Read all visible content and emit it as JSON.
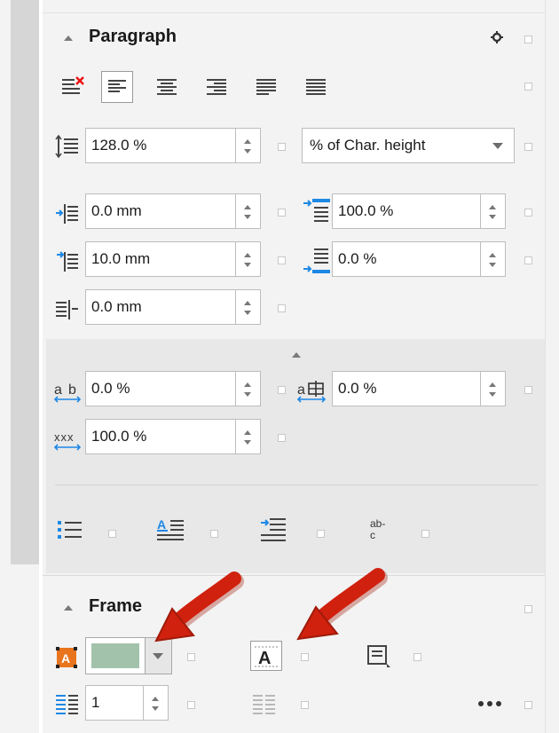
{
  "colors": {
    "accent_blue": "#1e88e5",
    "frame_fill": "#a3c2ac",
    "arrow_red": "#d0210e",
    "frame_icon_orange": "#e8741e"
  },
  "paragraph": {
    "title": "Paragraph",
    "line_spacing": {
      "value": "128.0 %",
      "mode": "% of Char. height"
    },
    "indent_before": "0.0 mm",
    "indent_after": "10.0 mm",
    "indent_right": "0.0 mm",
    "spacing_above": "100.0 %",
    "spacing_below": "0.0 %",
    "char_spacing": "0.0 %",
    "lang_spacing": "0.0 %",
    "char_width": "100.0 %",
    "align_icons": [
      "no-alignment-icon",
      "align-left-icon",
      "align-center-icon",
      "align-right-icon",
      "justify-full-icon",
      "justify-all-icon"
    ]
  },
  "frame": {
    "title": "Frame",
    "columns": "1"
  }
}
